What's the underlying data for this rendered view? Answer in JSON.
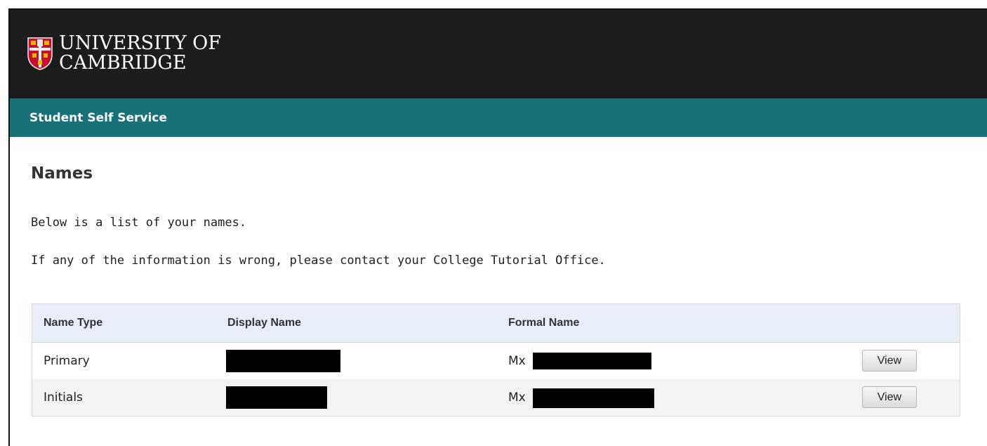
{
  "header": {
    "logo_line1": "UNIVERSITY OF",
    "logo_line2": "CAMBRIDGE",
    "logo_icon": "university-crest-icon",
    "section_title": "Student Self Service"
  },
  "page": {
    "title": "Names",
    "intro": "Below is a list of your names.",
    "notice": "If any of the information is wrong, please contact your College Tutorial Office."
  },
  "table": {
    "columns": [
      "Name Type",
      "Display Name",
      "Formal Name",
      ""
    ],
    "rows": [
      {
        "name_type": "Primary",
        "display_name": "",
        "formal_prefix": "Mx",
        "action": "View"
      },
      {
        "name_type": "Initials",
        "display_name": "",
        "formal_prefix": "Mx",
        "action": "View"
      }
    ]
  },
  "colors": {
    "topbar": "#1c1c1c",
    "subbar": "#17707a",
    "table_header": "#e7eef8"
  }
}
